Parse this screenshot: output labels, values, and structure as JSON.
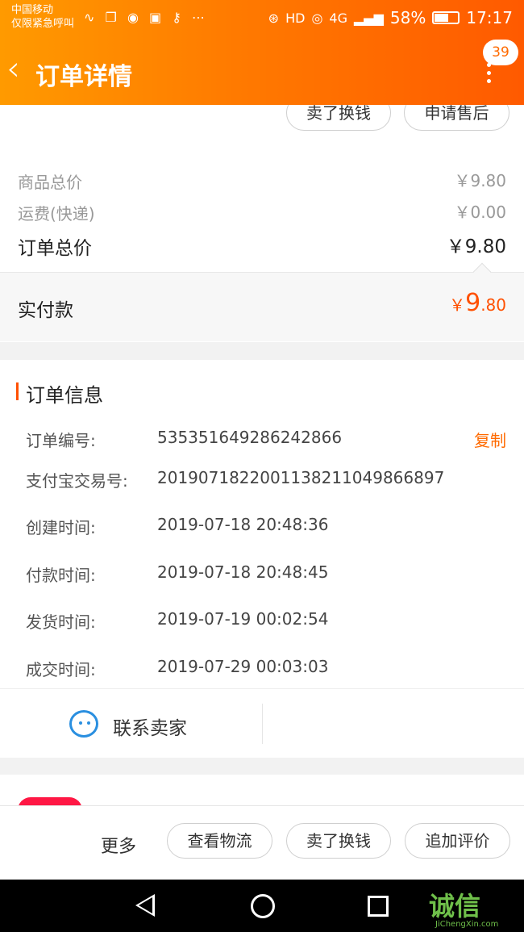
{
  "status_bar": {
    "carrier_line1": "中国移动",
    "carrier_line2": "仅限紧急呼叫",
    "battery_percent": "58%",
    "time": "17:17",
    "network": "4G",
    "hd": "HD"
  },
  "header": {
    "title": "订单详情",
    "message_count": "39"
  },
  "top_actions": {
    "sell_label": "卖了换钱",
    "after_sale_label": "申请售后"
  },
  "price_summary": {
    "goods_total_label": "商品总价",
    "goods_total_value": "￥9.80",
    "shipping_label": "运费(快递)",
    "shipping_value": "￥0.00",
    "order_total_label": "订单总价",
    "order_total_value": "￥9.80",
    "paid_label": "实付款",
    "paid_currency": "￥",
    "paid_int": "9",
    "paid_dec": ".80"
  },
  "order_info": {
    "section_title": "订单信息",
    "copy_label": "复制",
    "rows": [
      {
        "label": "订单编号:",
        "value": "535351649286242866"
      },
      {
        "label": "支付宝交易号:",
        "value": "2019071822001138211049866897"
      },
      {
        "label": "创建时间:",
        "value": "2019-07-18 20:48:36"
      },
      {
        "label": "付款时间:",
        "value": "2019-07-18 20:48:45"
      },
      {
        "label": "发货时间:",
        "value": "2019-07-19 00:02:54"
      },
      {
        "label": "成交时间:",
        "value": "2019-07-29 00:03:03"
      }
    ]
  },
  "contact": {
    "label": "联系卖家"
  },
  "bottom_bar": {
    "more_label": "更多",
    "logistics_label": "查看物流",
    "sell_label": "卖了换钱",
    "review_label": "追加评价"
  },
  "watermark": {
    "text": "诚信",
    "sub": "JiChengXin.com"
  },
  "colors": {
    "accent": "#ff6a00",
    "price": "#ff5000",
    "contact_icon": "#2a8fe0"
  }
}
